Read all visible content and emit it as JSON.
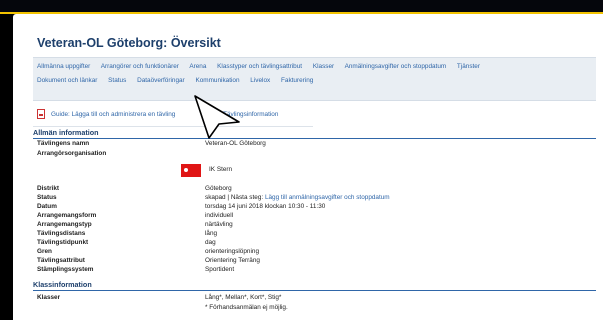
{
  "page_title": "Veteran-OL Göteborg: Översikt",
  "nav": {
    "row1": [
      "Allmänna uppgifter",
      "Arrangörer och funktionärer",
      "Arena",
      "Klasstyper och tävlingsattribut",
      "Klasser",
      "Anmälningsavgifter och stoppdatum",
      "Tjänster"
    ],
    "row2": [
      "Dokument och länkar",
      "Status",
      "Dataöverföringar",
      "Kommunikation",
      "Livelox",
      "Fakturering"
    ]
  },
  "guide": {
    "text_before": "Guide: Lägga till och administrera en tävling",
    "text_after": "Tävlingsinformation"
  },
  "sections": {
    "general": "Allmän information",
    "class": "Klassinformation"
  },
  "general": {
    "name_label": "Tävlingens namn",
    "name_value": "Veteran-OL Göteborg",
    "org_label": "Arrangörsorganisation",
    "org_value": "IK Stern",
    "district_label": "Distrikt",
    "district_value": "Göteborg",
    "status_label": "Status",
    "status_value": "skapad | Nästa steg:",
    "status_link": "Lägg till anmälningsavgifter och stoppdatum",
    "date_label": "Datum",
    "date_value": "torsdag 14 juni 2018 klockan 10:30 - 11:30",
    "form_label": "Arrangemangsform",
    "form_value": "individuell",
    "type_label": "Arrangemangstyp",
    "type_value": "närtävling",
    "dist_label": "Tävlingsdistans",
    "dist_value": "lång",
    "time_label": "Tävlingstidpunkt",
    "time_value": "dag",
    "branch_label": "Gren",
    "branch_value": "orienteringslöpning",
    "attr_label": "Tävlingsattribut",
    "attr_value": "Orientering Terräng",
    "punch_label": "Stämplingssystem",
    "punch_value": "Sportident"
  },
  "classinfo": {
    "classes_label": "Klasser",
    "classes_value": "Lång*, Mellan*, Kort*, Stig*",
    "note": "* Förhandsanmälan ej möjlig."
  },
  "colors": {
    "accent": "#f2c300",
    "link": "#2f66a8",
    "heading": "#1d3f6b",
    "flag": "#e01515"
  }
}
